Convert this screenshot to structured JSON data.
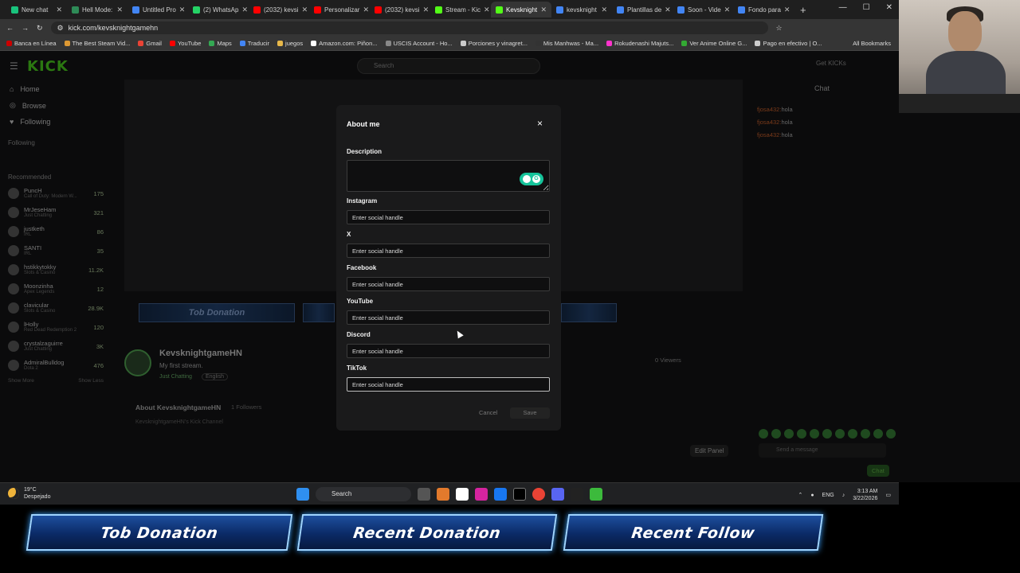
{
  "browser": {
    "tabs": [
      {
        "label": "New chat",
        "color": "#19c37d"
      },
      {
        "label": "Hell Mode:",
        "color": "#2e8b57"
      },
      {
        "label": "Untitled Pro",
        "color": "#4285f4"
      },
      {
        "label": "(2) WhatsAp",
        "color": "#25d366"
      },
      {
        "label": "(2032) kevsi",
        "color": "#ff0000"
      },
      {
        "label": "Personalizar",
        "color": "#ff0000"
      },
      {
        "label": "(2032) kevsi",
        "color": "#ff0000"
      },
      {
        "label": "Stream - Kic",
        "color": "#53fc18"
      },
      {
        "label": "Kevsknight",
        "color": "#53fc18",
        "active": true
      },
      {
        "label": "kevsknight",
        "color": "#4285f4"
      },
      {
        "label": "Plantillas de",
        "color": "#4285f4"
      },
      {
        "label": "Soon - Vide",
        "color": "#4285f4"
      },
      {
        "label": "Fondo para",
        "color": "#4285f4"
      }
    ],
    "new_tab": "+",
    "url": "kick.com/kevsknightgamehn",
    "bookmarks": [
      "Banca en Línea",
      "The Best Steam Vid...",
      "Gmail",
      "YouTube",
      "Maps",
      "Traducir",
      "juegos",
      "Amazon.com: Piñon...",
      "USCIS Account - Ho...",
      "Porciones y vinagret...",
      "Mis Manhwas - Ma...",
      "Rokudenashi Majuts...",
      "Ver Anime Online G...",
      "Pago en efectivo | O..."
    ],
    "all_bookmarks": "All Bookmarks"
  },
  "kick": {
    "logo": "KICK",
    "search_placeholder": "Search",
    "get_kicks": "Get KICKs",
    "nav": [
      {
        "label": "Home",
        "icon": "home-icon"
      },
      {
        "label": "Browse",
        "icon": "compass-icon"
      },
      {
        "label": "Following",
        "icon": "heart-icon"
      }
    ],
    "following_title": "Following",
    "recommended_title": "Recommended",
    "recommended": [
      {
        "name": "PuncH",
        "game": "Call of Duty: Modern W...",
        "count": "175"
      },
      {
        "name": "MrJeseHam",
        "game": "Just Chatting",
        "count": "321"
      },
      {
        "name": "justketh",
        "game": "IRL",
        "count": "86"
      },
      {
        "name": "SANTI",
        "game": "IRL",
        "count": "35"
      },
      {
        "name": "hstikkytokky",
        "game": "Slots & Casino",
        "count": "11.2K"
      },
      {
        "name": "Moonzinha",
        "game": "Apex Legends",
        "count": "12"
      },
      {
        "name": "clavicular",
        "game": "Slots & Casino",
        "count": "28.9K"
      },
      {
        "name": "lHolly",
        "game": "Red Dead Redemption 2",
        "count": "120"
      },
      {
        "name": "crystalzaguirre",
        "game": "Just Chatting",
        "count": "3K"
      },
      {
        "name": "AdmiralBulldog",
        "game": "Dota 2",
        "count": "476"
      }
    ],
    "show_more": "Show More",
    "show_less": "Show Less",
    "small_banners": [
      "Tob Donation"
    ],
    "channel_name": "KevsknightgameHN",
    "channel_sub": "My first stream.",
    "channel_category": "Just Chatting",
    "channel_lang": "English",
    "viewers": "0 Viewers",
    "about_title": "About KevsknightgameHN",
    "about_followers": "1 Followers",
    "about_sub": "KevsknightgameHN's Kick Channel",
    "edit_panel": "Edit Panel",
    "chat_title": "Chat",
    "chat_messages": [
      {
        "user": "fjosa432:",
        "text": "hola"
      },
      {
        "user": "fjosa432:",
        "text": "hola"
      },
      {
        "user": "fjosa432:",
        "text": "hola"
      }
    ],
    "send_placeholder": "Send a message",
    "chat_button": "Chat"
  },
  "modal": {
    "title": "About me",
    "close": "×",
    "description_label": "Description",
    "fields": [
      {
        "label": "Instagram",
        "placeholder": "Enter social handle"
      },
      {
        "label": "X",
        "placeholder": "Enter social handle"
      },
      {
        "label": "Facebook",
        "placeholder": "Enter social handle"
      },
      {
        "label": "YouTube",
        "placeholder": "Enter social handle"
      },
      {
        "label": "Discord",
        "placeholder": "Enter social handle"
      },
      {
        "label": "TikTok",
        "placeholder": "Enter social handle"
      }
    ],
    "cancel": "Cancel",
    "save": "Save"
  },
  "taskbar": {
    "temp": "19°C",
    "weather": "Despejado",
    "search": "Search",
    "lang": "ENG",
    "time": "3:13 AM",
    "date": "3/22/2026"
  },
  "overlay_banners": [
    "Tob Donation",
    "Recent Donation",
    "Recent Follow"
  ]
}
